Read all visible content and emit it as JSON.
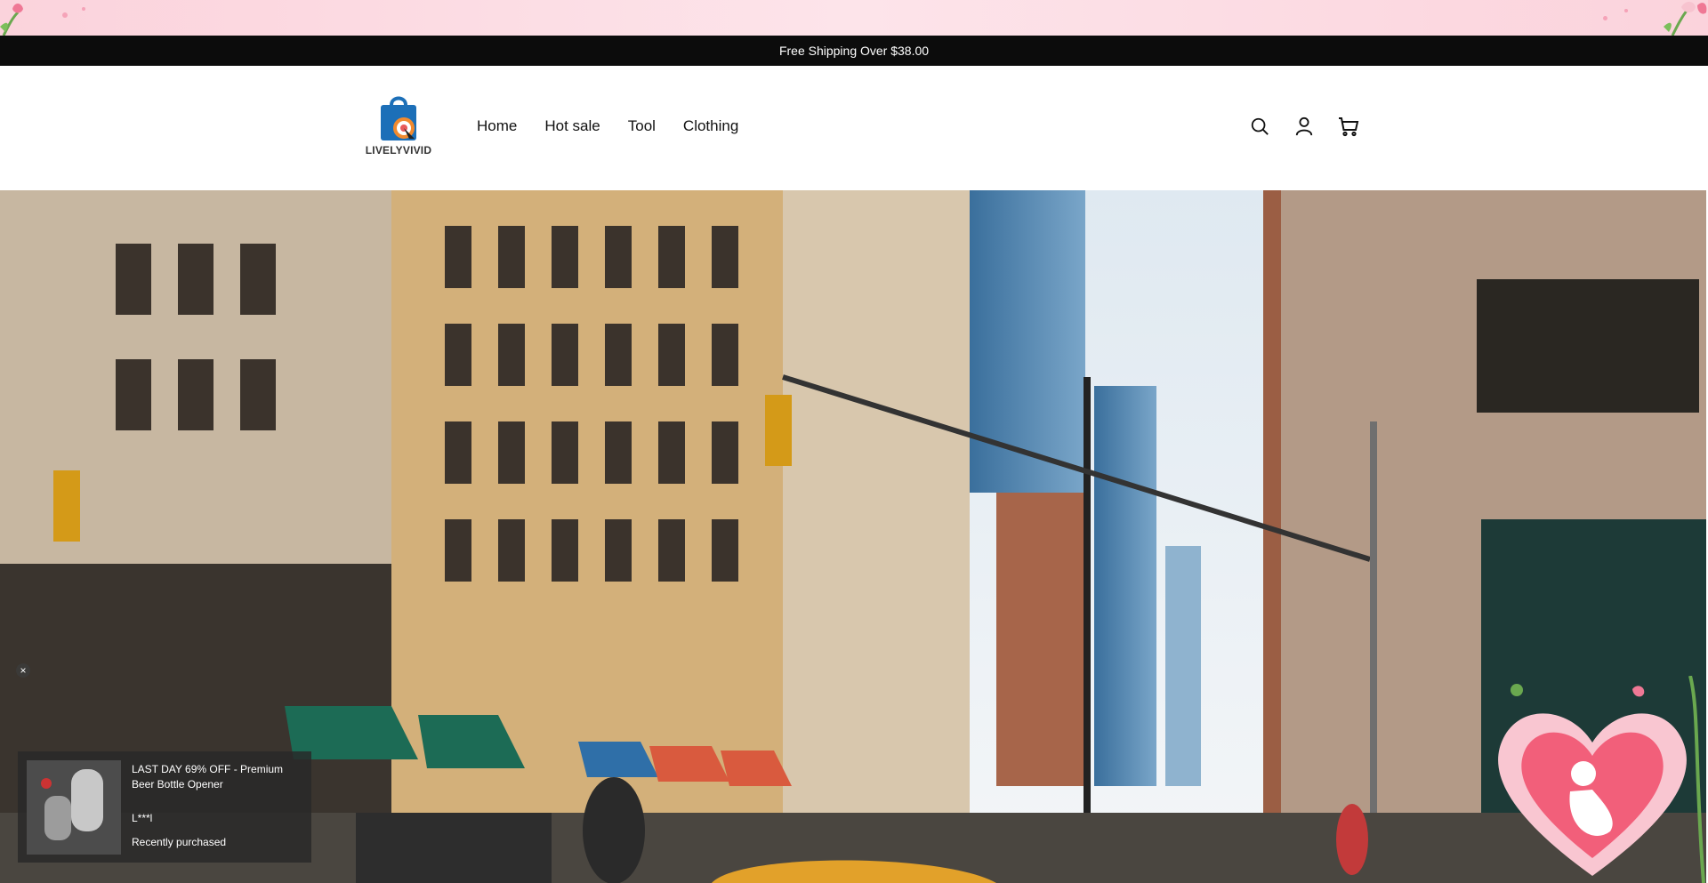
{
  "announcement": {
    "text": "Free Shipping Over $38.00"
  },
  "header": {
    "logo_text": "LIVELYVIVID",
    "nav": [
      {
        "label": "Home"
      },
      {
        "label": "Hot sale"
      },
      {
        "label": "Tool"
      },
      {
        "label": "Clothing"
      }
    ],
    "icons": [
      "search-icon",
      "account-icon",
      "cart-icon"
    ]
  },
  "purchase_popup": {
    "title": "LAST DAY 69% OFF - Premium Beer Bottle Opener",
    "buyer": "L***l",
    "status": "Recently purchased",
    "close_label": "×"
  },
  "colors": {
    "announce_bg": "#0c0c0c",
    "strip_pink": "#fbd3dc",
    "logo_blue": "#1c6fb8",
    "logo_orange": "#f28a2e",
    "heart_pink": "#f25f7a"
  }
}
